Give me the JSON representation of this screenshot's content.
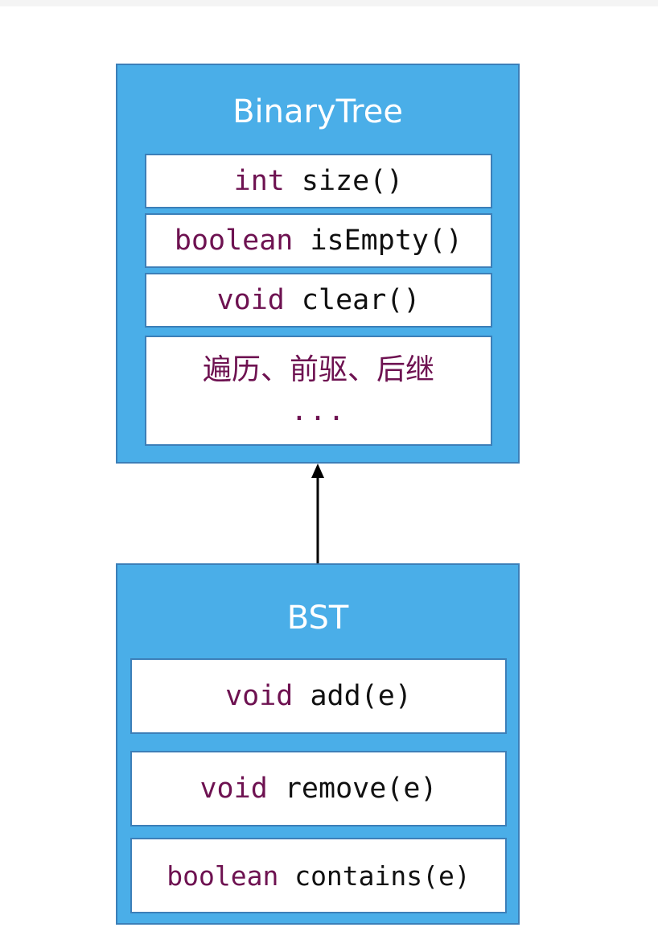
{
  "parent_class": {
    "name": "BinaryTree",
    "methods": [
      {
        "keyword": "int",
        "rest": " size()"
      },
      {
        "keyword": "boolean",
        "rest": " isEmpty()"
      },
      {
        "keyword": "void",
        "rest": " clear()"
      }
    ],
    "extra": {
      "line1": "遍历、前驱、后继",
      "line2": "..."
    }
  },
  "child_class": {
    "name": "BST",
    "methods": [
      {
        "keyword": "void",
        "rest": " add(e)"
      },
      {
        "keyword": "void",
        "rest": " remove(e)"
      },
      {
        "keyword": "boolean",
        "rest": " contains(e)"
      }
    ]
  },
  "colors": {
    "class_fill": "#4aaee8",
    "border": "#3c7fb8",
    "keyword": "#6e1251",
    "text": "#111111",
    "arrow": "#000000"
  }
}
